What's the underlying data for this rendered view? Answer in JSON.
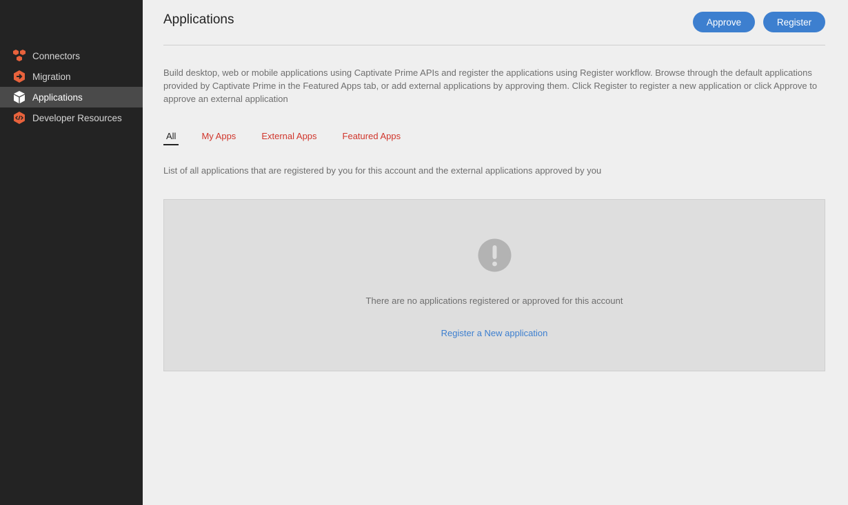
{
  "sidebar": {
    "items": [
      {
        "label": "Connectors",
        "icon": "connectors-icon",
        "active": false
      },
      {
        "label": "Migration",
        "icon": "migration-icon",
        "active": false
      },
      {
        "label": "Applications",
        "icon": "applications-icon",
        "active": true
      },
      {
        "label": "Developer Resources",
        "icon": "developer-resources-icon",
        "active": false
      }
    ]
  },
  "header": {
    "title": "Applications",
    "approve_label": "Approve",
    "register_label": "Register"
  },
  "main": {
    "description": "Build desktop, web or mobile applications using Captivate Prime APIs and register the applications using Register workflow. Browse through the default applications provided by Captivate Prime in the Featured Apps tab, or add external applications by approving them. Click Register to register a new application or click Approve to approve an external application",
    "tabs": [
      {
        "label": "All",
        "active": true
      },
      {
        "label": "My Apps",
        "active": false
      },
      {
        "label": "External Apps",
        "active": false
      },
      {
        "label": "Featured Apps",
        "active": false
      }
    ],
    "list_description": "List of all applications that are registered by you for this account and the external applications approved by you",
    "empty_state": {
      "icon": "alert-icon",
      "message": "There are no applications registered or approved for this account",
      "link_label": "Register a New application"
    }
  },
  "colors": {
    "sidebar_bg": "#232323",
    "accent": "#3d7fcf",
    "tab_link": "#d0352b",
    "icon_orange": "#e8623c"
  }
}
